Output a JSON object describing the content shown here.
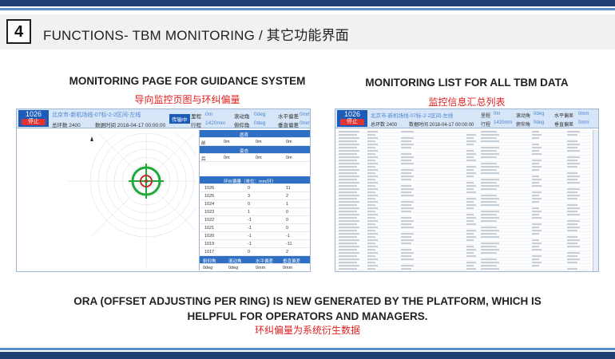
{
  "header": {
    "number": "4",
    "title": "FUNCTIONS- TBM MONITORING / 其它功能界面"
  },
  "left_panel": {
    "caption_en": "MONITORING PAGE FOR GUIDANCE SYSTEM",
    "caption_cn": "导向监控页图与环纠偏量",
    "screen": {
      "ring_no": "1026",
      "ring_state": "停止",
      "line_name": "北京市-新机场线-07标-2-2区间-左线",
      "total_rings": "总环数 2400",
      "data_time": "数据时间 2018-04-17 00:00:00",
      "tx_button": "传输中",
      "f1_label": "里程",
      "f1_value": "0m",
      "f2_label": "行程",
      "f2_value": "1420mm",
      "f3_label": "滚动角",
      "f3_value": "0deg",
      "f4_label": "俯仰角",
      "f4_value": "0deg",
      "f5_label": "水平偏差",
      "f5_value": "0mm",
      "f6_label": "垂直偏差",
      "f6_value": "0mm",
      "panel_title_1": "盾首",
      "panel_title_2": "环纠偏量（单位：mm/环）",
      "panel_title_3": "姿态",
      "panel_rows": [
        [
          "1026",
          "0",
          "11"
        ],
        [
          "1025",
          "3",
          "2"
        ],
        [
          "1024",
          "0",
          "1"
        ],
        [
          "1023",
          "1",
          "0"
        ],
        [
          "1022",
          "-1",
          "0"
        ],
        [
          "1021",
          "-1",
          "0"
        ],
        [
          "1020",
          "-1",
          "-1"
        ],
        [
          "1019",
          "-1",
          "-11"
        ],
        [
          "1017",
          "0",
          "2"
        ]
      ],
      "panel_bottom_head": [
        "俯仰角",
        "滚动角",
        "水平偏差",
        "垂直偏差"
      ],
      "panel_bottom_vals": [
        "0deg",
        "0deg",
        "0mm",
        "0mm"
      ]
    }
  },
  "right_panel": {
    "caption_en": "MONITORING LIST FOR ALL TBM DATA",
    "caption_cn": "监控信息汇总列表",
    "screen": {
      "ring_no": "1026",
      "ring_state": "停止",
      "line_name": "北京市-新机场线-07标-2-2区间-左线",
      "total_rings": "总环数 2400",
      "data_time": "数据时间 2018-04-17 00:00:00",
      "f1_label": "里程",
      "f1_value": "0m",
      "f2_label": "行程",
      "f2_value": "1420mm",
      "f3_label": "滚动角",
      "f3_value": "0deg",
      "f4_label": "俯仰角",
      "f4_value": "0deg",
      "f5_label": "水平偏差",
      "f5_value": "0mm",
      "f6_label": "垂直偏差",
      "f6_value": "0mm"
    }
  },
  "footer": {
    "line1": "ORA (OFFSET ADJUSTING PER RING) IS NEW GENERATED BY THE PLATFORM, WHICH IS",
    "line2": "HELPFUL FOR OPERATORS AND MANAGERS.",
    "cn": "环纠偏量为系统衍生数据"
  },
  "colors": {
    "brand_dark": "#1f3f73",
    "brand_light": "#5b8dd0",
    "accent_red": "#e02020",
    "target_green": "#1fa83a",
    "badge_blue": "#1c5bb8"
  }
}
